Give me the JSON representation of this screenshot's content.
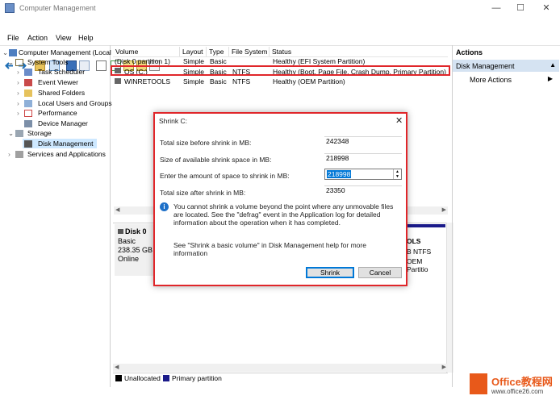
{
  "window": {
    "title": "Computer Management"
  },
  "menu": [
    "File",
    "Action",
    "View",
    "Help"
  ],
  "tree": {
    "root": "Computer Management (Local",
    "system_tools": "System Tools",
    "task_scheduler": "Task Scheduler",
    "event_viewer": "Event Viewer",
    "shared_folders": "Shared Folders",
    "local_users": "Local Users and Groups",
    "performance": "Performance",
    "device_manager": "Device Manager",
    "storage": "Storage",
    "disk_management": "Disk Management",
    "services": "Services and Applications"
  },
  "volumes": {
    "columns": [
      "Volume",
      "Layout",
      "Type",
      "File System",
      "Status"
    ],
    "rows": [
      {
        "volume": "(Disk 0 partition 1)",
        "layout": "Simple",
        "type": "Basic",
        "fs": "",
        "status": "Healthy (EFI System Partition)"
      },
      {
        "volume": "OS (C:)",
        "layout": "Simple",
        "type": "Basic",
        "fs": "NTFS",
        "status": "Healthy (Boot, Page File, Crash Dump, Primary Partition)"
      },
      {
        "volume": "WINRETOOLS",
        "layout": "Simple",
        "type": "Basic",
        "fs": "NTFS",
        "status": "Healthy (OEM Partition)"
      }
    ]
  },
  "disk": {
    "name": "Disk 0",
    "type": "Basic",
    "size": "238.35 GB",
    "state": "Online",
    "partition_name": "OLS",
    "partition_size": "B NTFS",
    "partition_status": "OEM Partitio"
  },
  "legend": {
    "unallocated": "Unallocated",
    "primary": "Primary partition",
    "colors": {
      "unallocated": "#000000",
      "primary": "#1b1b8a"
    }
  },
  "actions": {
    "header": "Actions",
    "section": "Disk Management",
    "more": "More Actions"
  },
  "dialog": {
    "title": "Shrink C:",
    "total_before_label": "Total size before shrink in MB:",
    "total_before": "242348",
    "available_label": "Size of available shrink space in MB:",
    "available": "218998",
    "amount_label": "Enter the amount of space to shrink in MB:",
    "amount": "218998",
    "total_after_label": "Total size after shrink in MB:",
    "total_after": "23350",
    "info": "You cannot shrink a volume beyond the point where any unmovable files are located. See the \"defrag\" event in the Application log for detailed information about the operation when it has completed.",
    "help": "See \"Shrink a basic volume\" in Disk Management help for more information",
    "shrink_button": "Shrink",
    "cancel_button": "Cancel"
  },
  "watermark": {
    "brand": "Office教程网",
    "url": "www.office26.com"
  },
  "colors": {
    "highlight": "#e0262a",
    "selection": "#cde8ff",
    "accent": "#0078d7"
  }
}
